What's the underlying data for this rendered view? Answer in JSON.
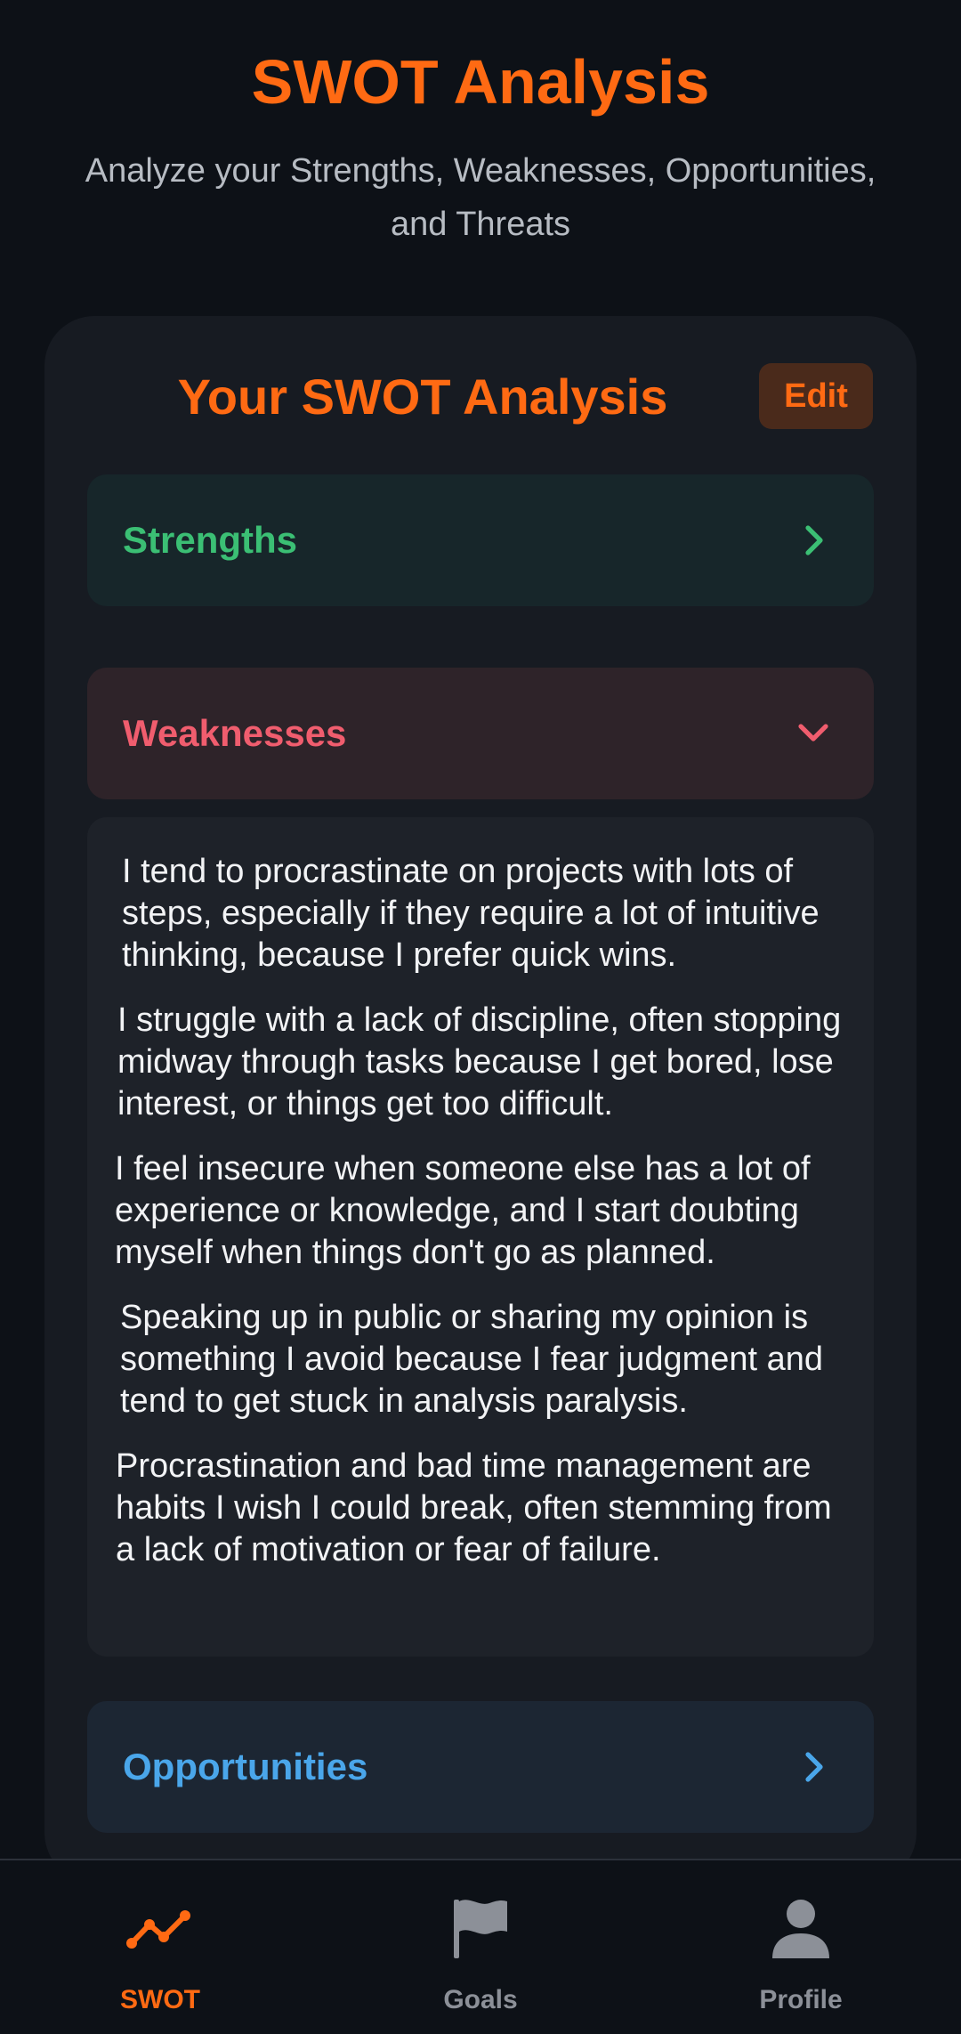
{
  "header": {
    "title": "SWOT Analysis",
    "subtitle": "Analyze your Strengths, Weaknesses, Opportunities, and Threats"
  },
  "card": {
    "title": "Your SWOT Analysis",
    "edit_label": "Edit"
  },
  "sections": {
    "strengths": {
      "label": "Strengths",
      "color": "#3bbf74",
      "expanded": false
    },
    "weaknesses": {
      "label": "Weaknesses",
      "color": "#f05d6e",
      "expanded": true,
      "items": [
        "I tend to procrastinate on projects with lots of steps, especially if they require a lot of intuitive thinking, because I prefer quick wins.",
        "I struggle with a lack of discipline, often stopping midway through tasks because I get bored, lose interest, or things get too difficult.",
        "I feel insecure when someone else has a lot of experience or knowledge, and I start doubting myself when things don't go as planned.",
        "Speaking up in public or sharing my opinion is something I avoid because I fear judgment and tend to get stuck in analysis paralysis.",
        "Procrastination and bad time management are habits I wish I could break, often stemming from a lack of motivation or fear of failure."
      ]
    },
    "opportunities": {
      "label": "Opportunities",
      "color": "#4aa6ea",
      "expanded": false
    }
  },
  "nav": {
    "items": [
      {
        "label": "SWOT",
        "icon": "trend-line-icon",
        "active": true
      },
      {
        "label": "Goals",
        "icon": "flag-icon",
        "active": false
      },
      {
        "label": "Profile",
        "icon": "person-icon",
        "active": false
      }
    ]
  },
  "colors": {
    "accent": "#ff6a13",
    "background": "#0d1117",
    "card": "#171b22"
  }
}
